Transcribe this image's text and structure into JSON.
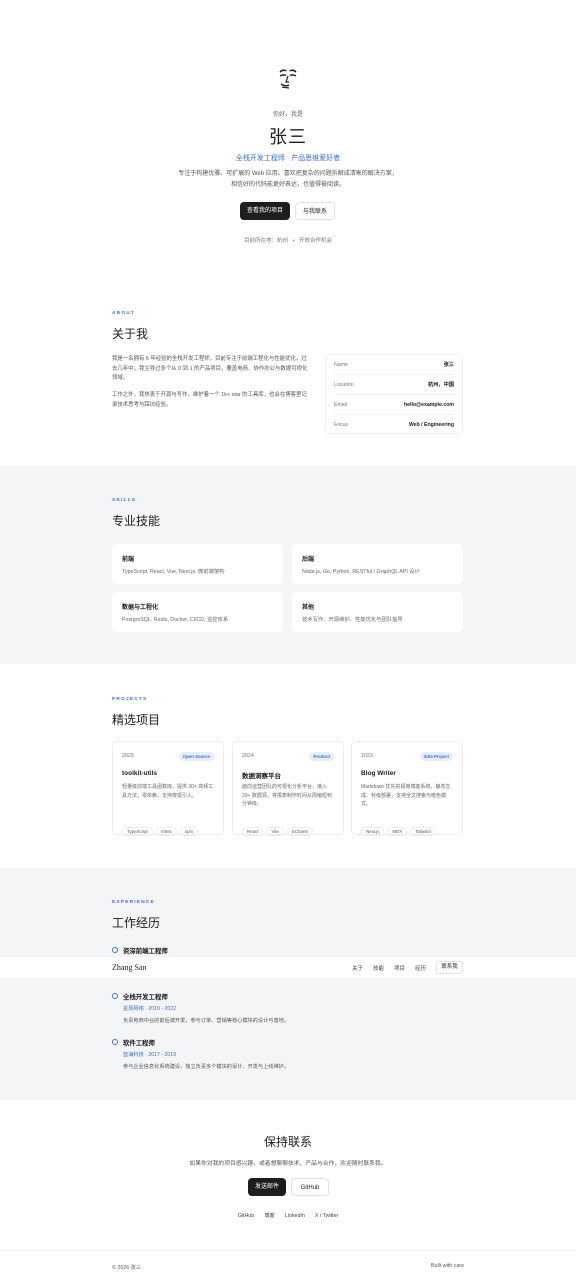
{
  "hero": {
    "greeting": "你好，我是",
    "name": "张三",
    "tagline": "全栈开发工程师 · 产品思维爱好者",
    "intro": "专注于构建优雅、可扩展的 Web 应用。喜欢把复杂的问题拆解成清晰的解决方案，相信好的代码能更好表达，也值得被阅读。",
    "primary_button": "查看我的项目",
    "secondary_button": "与我联系",
    "location_label": "目前所在地：杭州",
    "location_dot": "•",
    "availability": "开放合作机会"
  },
  "about": {
    "eyebrow": "ABOUT",
    "title": "关于我",
    "para1": "我是一名拥有 6 年经验的全栈开发工程师，目前专注于前端工程化与性能优化。过去几年中，我主导过多个从 0 到 1 的产品项目，覆盖电商、协作办公与数据可视化领域。",
    "para2": "工作之外，我热衷于开源与写作，维护着一个 1k+ star 的工具库，也会在博客里记录技术思考与踩坑经验。",
    "info": [
      {
        "k": "Name",
        "v": "张三"
      },
      {
        "k": "Location",
        "v": "杭州，中国"
      },
      {
        "k": "Email",
        "v": "hello@example.com"
      },
      {
        "k": "Focus",
        "v": "Web / Engineering"
      }
    ]
  },
  "skills": {
    "eyebrow": "SKILLS",
    "title": "专业技能",
    "items": [
      {
        "title": "前端",
        "desc": "TypeScript, React, Vue, Next.js, 微前端架构"
      },
      {
        "title": "后端",
        "desc": "Node.js, Go, Python, RESTful / GraphQL API 设计"
      },
      {
        "title": "数据与工程化",
        "desc": "PostgreSQL, Redis, Docker, CI/CD, 监控体系"
      },
      {
        "title": "其他",
        "desc": "技术写作、开源维护、性能优化与团队指导"
      }
    ]
  },
  "projects": {
    "eyebrow": "PROJECTS",
    "title": "精选项目",
    "items": [
      {
        "year": "2025",
        "badge": "Open Source",
        "title": "toolkit-utils",
        "desc": "轻量级前端工具函数库，提供 30+ 高频工具方法，零依赖，支持按需引入。",
        "tags": [
          "TypeScript",
          "Vitest",
          "npm"
        ]
      },
      {
        "year": "2024",
        "badge": "Product",
        "title": "数据洞察平台",
        "desc": "面向运营团队的可视化分析平台，接入 20+ 数据源，将报表制作时间从周缩短到分钟级。",
        "tags": [
          "React",
          "Vite",
          "ECharts"
        ]
      },
      {
        "year": "2023",
        "badge": "Side Project",
        "title": "Blog Writer",
        "desc": "Markdown 优先的极简博客系统，静态生成、秒级部署，支持全文搜索与暗色模式。",
        "tags": [
          "Next.js",
          "MDX",
          "Tailwind"
        ]
      }
    ]
  },
  "experience": {
    "eyebrow": "EXPERIENCE",
    "title": "工作经历",
    "items": [
      {
        "role": "资深前端工程师",
        "company": "",
        "desc": ""
      },
      {
        "role": "全栈开发工程师",
        "company": "星辰网络 · 2019 - 2022",
        "desc": "负责电商中台的前后端开发，参与订单、营销等核心模块的设计与落地。"
      },
      {
        "role": "软件工程师",
        "company": "蓝海科技 · 2017 - 2019",
        "desc": "参与企业信息化系统建设，独立负责多个模块的设计、开发与上线维护。"
      }
    ]
  },
  "navbar": {
    "brand": "Zhang San",
    "links": [
      "关于",
      "技能",
      "项目",
      "经历"
    ],
    "cta": "联系我"
  },
  "contact": {
    "title": "保持联系",
    "subtitle": "如果你对我的项目感兴趣，或者想聊聊技术、产品与合作，欢迎随时联系我。",
    "primary_button": "发送邮件",
    "secondary_button": "GitHub",
    "links": [
      "GitHub",
      "博客",
      "LinkedIn",
      "X / Twitter"
    ]
  },
  "footer": {
    "copyright": "© 2026 张三",
    "note": "Built with care"
  }
}
